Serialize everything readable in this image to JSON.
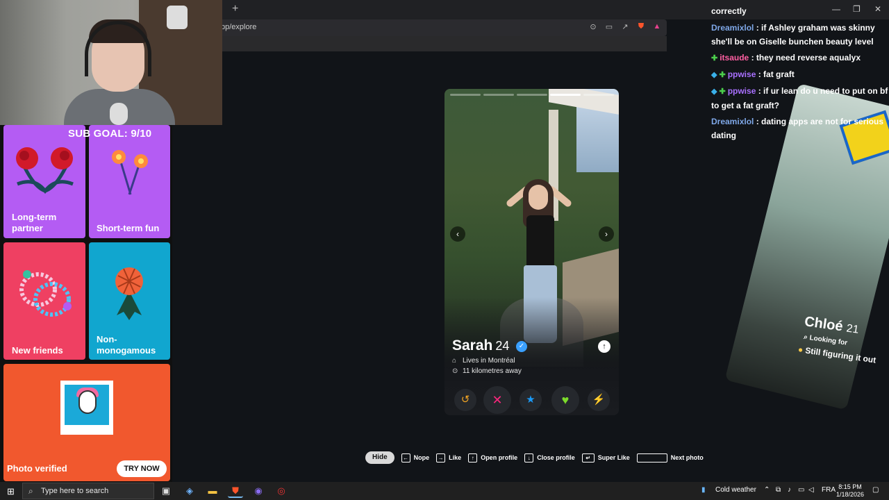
{
  "browser": {
    "url": "pp/explore",
    "new_tab": "+",
    "win_min": "—",
    "win_max": "❐",
    "win_close": "✕"
  },
  "stream": {
    "sub_goal": "SUB GOAL: 9/10"
  },
  "tiles": [
    {
      "label": "Long-term partner",
      "color": "#b45cf3"
    },
    {
      "label": "Short-term fun",
      "color": "#b45cf3"
    },
    {
      "label": "New friends",
      "color": "#ef4062"
    },
    {
      "label": "Non-monogamous",
      "color": "#11a6cf"
    },
    {
      "label": "Photo verified",
      "color": "#f1582e",
      "button": "TRY NOW"
    }
  ],
  "profile": {
    "name": "Sarah",
    "age": "24",
    "lives": "Lives in Montréal",
    "distance": "11 kilometres away",
    "photos_total": 5,
    "photo_current": 4,
    "prev_arrow": "‹",
    "next_arrow": "›",
    "verified_icon": "✓",
    "info_icon": "↑"
  },
  "actions": [
    {
      "name": "rewind",
      "glyph": "↺",
      "color": "#f5a623"
    },
    {
      "name": "nope",
      "glyph": "✕",
      "color": "#fd267d"
    },
    {
      "name": "super-like",
      "glyph": "★",
      "color": "#1b9af7"
    },
    {
      "name": "like",
      "glyph": "♥",
      "color": "#7cdb2b"
    },
    {
      "name": "boost",
      "glyph": "⚡",
      "color": "#a24bf5"
    }
  ],
  "chat": [
    {
      "user": "",
      "text": "correctly"
    },
    {
      "user": "Dreamixlol",
      "text": "if Ashley graham was skinny she'll be on Giselle bunchen beauty level"
    },
    {
      "user": "itsaude",
      "text": "they need reverse aqualyx"
    },
    {
      "user": "ppwise",
      "text": "fat graft"
    },
    {
      "user": "ppwise",
      "text": "if ur lean do u need to put on bf to get a fat graft?"
    },
    {
      "user": "Dreamixlol",
      "text": "dating apps are not for serious dating"
    }
  ],
  "next_card": {
    "name": "Chloé",
    "age": "21",
    "looking_for": "Looking for",
    "figuring": "Still figuring it out"
  },
  "shortcuts": {
    "hide": "Hide",
    "nope": "Nope",
    "like": "Like",
    "open_profile": "Open profile",
    "close_profile": "Close profile",
    "super_like": "Super Like",
    "next_photo": "Next photo"
  },
  "taskbar": {
    "search_placeholder": "Type here to search",
    "weather": "Cold weather",
    "language": "FRA",
    "time": "8:15 PM",
    "date": "1/18/2026"
  }
}
